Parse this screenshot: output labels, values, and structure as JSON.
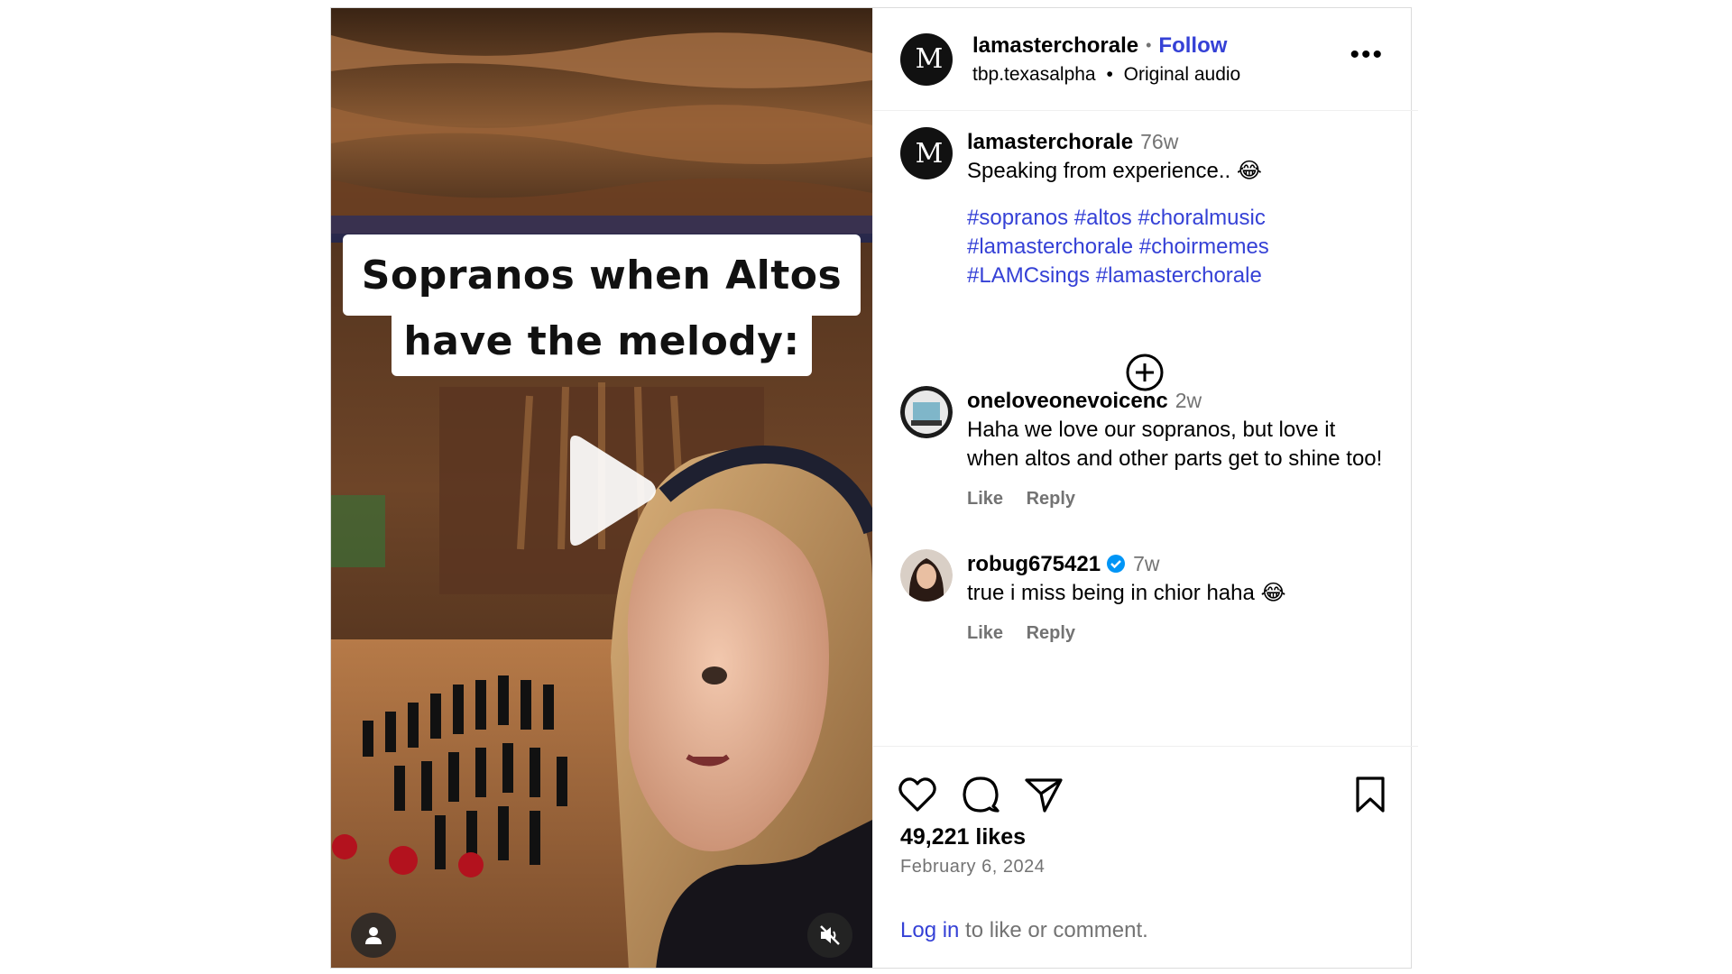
{
  "media": {
    "caption_line1": "Sopranos when Altos",
    "caption_line2": "have the melody:"
  },
  "header": {
    "username": "lamasterchorale",
    "separator": "•",
    "follow_label": "Follow",
    "audio_user": "tbp.texasalpha",
    "audio_separator": "•",
    "audio_label": "Original audio",
    "more_label": "•••",
    "avatar_letter": "M"
  },
  "caption": {
    "username": "lamasterchorale",
    "time": "76w",
    "text": "Speaking from experience.. 😂",
    "tags_line1": "#sopranos #altos #choralmusic",
    "tags_line2": "#lamasterchorale #choirmemes",
    "tags_line3": "#LAMCsings #lamasterchorale"
  },
  "comments": [
    {
      "username": "oneloveonevoicenc",
      "time": "2w",
      "text": "Haha we love our sopranos, but love it when altos and other parts get to shine too!",
      "like_label": "Like",
      "reply_label": "Reply"
    },
    {
      "username": "robug675421",
      "time": "7w",
      "text": "true i miss being in chior haha 😂",
      "like_label": "Like",
      "reply_label": "Reply"
    }
  ],
  "footer": {
    "likes": "49,221 likes",
    "date": "February 6, 2024",
    "login_link": "Log in",
    "login_rest": " to like or comment."
  },
  "colors": {
    "link": "#3541d6",
    "muted": "#737373",
    "border": "#dbdbdb"
  }
}
